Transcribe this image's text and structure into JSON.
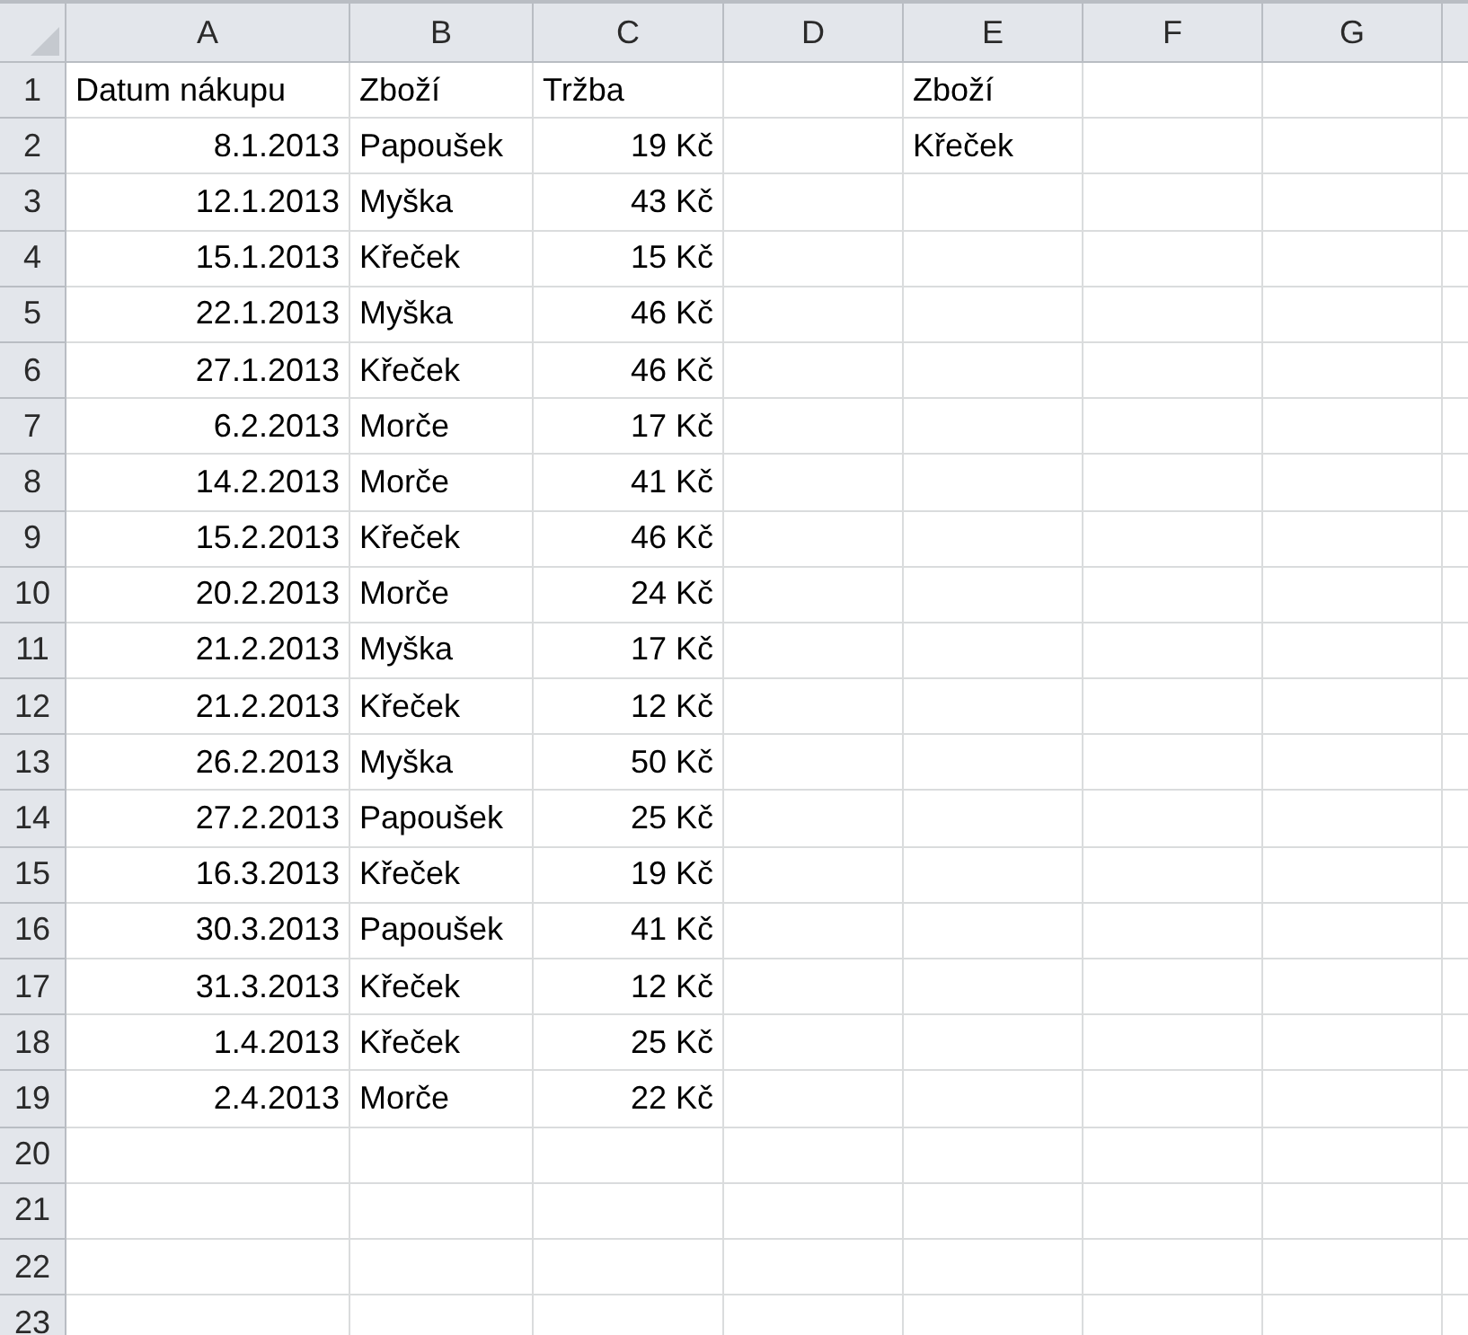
{
  "columns": [
    "A",
    "B",
    "C",
    "D",
    "E",
    "F",
    "G"
  ],
  "rows": [
    {
      "number": "1",
      "cells": [
        {
          "text": "Datum nákupu",
          "kind": "text"
        },
        {
          "text": "Zboží",
          "kind": "text"
        },
        {
          "text": "Tržba",
          "kind": "text"
        },
        null,
        {
          "text": "Zboží",
          "kind": "text"
        }
      ]
    },
    {
      "number": "2",
      "cells": [
        {
          "text": "8.1.2013",
          "kind": "number"
        },
        {
          "text": "Papoušek",
          "kind": "text"
        },
        {
          "text": "19 Kč",
          "kind": "number"
        },
        null,
        {
          "text": "Křeček",
          "kind": "text"
        }
      ]
    },
    {
      "number": "3",
      "cells": [
        {
          "text": "12.1.2013",
          "kind": "number"
        },
        {
          "text": "Myška",
          "kind": "text"
        },
        {
          "text": "43 Kč",
          "kind": "number"
        }
      ]
    },
    {
      "number": "4",
      "cells": [
        {
          "text": "15.1.2013",
          "kind": "number"
        },
        {
          "text": "Křeček",
          "kind": "text"
        },
        {
          "text": "15 Kč",
          "kind": "number"
        }
      ]
    },
    {
      "number": "5",
      "cells": [
        {
          "text": "22.1.2013",
          "kind": "number"
        },
        {
          "text": "Myška",
          "kind": "text"
        },
        {
          "text": "46 Kč",
          "kind": "number"
        }
      ]
    },
    {
      "number": "6",
      "cells": [
        {
          "text": "27.1.2013",
          "kind": "number"
        },
        {
          "text": "Křeček",
          "kind": "text"
        },
        {
          "text": "46 Kč",
          "kind": "number"
        }
      ]
    },
    {
      "number": "7",
      "cells": [
        {
          "text": "6.2.2013",
          "kind": "number"
        },
        {
          "text": "Morče",
          "kind": "text"
        },
        {
          "text": "17 Kč",
          "kind": "number"
        }
      ]
    },
    {
      "number": "8",
      "cells": [
        {
          "text": "14.2.2013",
          "kind": "number"
        },
        {
          "text": "Morče",
          "kind": "text"
        },
        {
          "text": "41 Kč",
          "kind": "number"
        }
      ]
    },
    {
      "number": "9",
      "cells": [
        {
          "text": "15.2.2013",
          "kind": "number"
        },
        {
          "text": "Křeček",
          "kind": "text"
        },
        {
          "text": "46 Kč",
          "kind": "number"
        }
      ]
    },
    {
      "number": "10",
      "cells": [
        {
          "text": "20.2.2013",
          "kind": "number"
        },
        {
          "text": "Morče",
          "kind": "text"
        },
        {
          "text": "24 Kč",
          "kind": "number"
        }
      ]
    },
    {
      "number": "11",
      "cells": [
        {
          "text": "21.2.2013",
          "kind": "number"
        },
        {
          "text": "Myška",
          "kind": "text"
        },
        {
          "text": "17 Kč",
          "kind": "number"
        }
      ]
    },
    {
      "number": "12",
      "cells": [
        {
          "text": "21.2.2013",
          "kind": "number"
        },
        {
          "text": "Křeček",
          "kind": "text"
        },
        {
          "text": "12 Kč",
          "kind": "number"
        }
      ]
    },
    {
      "number": "13",
      "cells": [
        {
          "text": "26.2.2013",
          "kind": "number"
        },
        {
          "text": "Myška",
          "kind": "text"
        },
        {
          "text": "50 Kč",
          "kind": "number"
        }
      ]
    },
    {
      "number": "14",
      "cells": [
        {
          "text": "27.2.2013",
          "kind": "number"
        },
        {
          "text": "Papoušek",
          "kind": "text"
        },
        {
          "text": "25 Kč",
          "kind": "number"
        }
      ]
    },
    {
      "number": "15",
      "cells": [
        {
          "text": "16.3.2013",
          "kind": "number"
        },
        {
          "text": "Křeček",
          "kind": "text"
        },
        {
          "text": "19 Kč",
          "kind": "number"
        }
      ]
    },
    {
      "number": "16",
      "cells": [
        {
          "text": "30.3.2013",
          "kind": "number"
        },
        {
          "text": "Papoušek",
          "kind": "text"
        },
        {
          "text": "41 Kč",
          "kind": "number"
        }
      ]
    },
    {
      "number": "17",
      "cells": [
        {
          "text": "31.3.2013",
          "kind": "number"
        },
        {
          "text": "Křeček",
          "kind": "text"
        },
        {
          "text": "12 Kč",
          "kind": "number"
        }
      ]
    },
    {
      "number": "18",
      "cells": [
        {
          "text": "1.4.2013",
          "kind": "number"
        },
        {
          "text": "Křeček",
          "kind": "text"
        },
        {
          "text": "25 Kč",
          "kind": "number"
        }
      ]
    },
    {
      "number": "19",
      "cells": [
        {
          "text": "2.4.2013",
          "kind": "number"
        },
        {
          "text": "Morče",
          "kind": "text"
        },
        {
          "text": "22 Kč",
          "kind": "number"
        }
      ]
    },
    {
      "number": "20"
    },
    {
      "number": "21"
    },
    {
      "number": "22"
    },
    {
      "number": "23"
    }
  ]
}
